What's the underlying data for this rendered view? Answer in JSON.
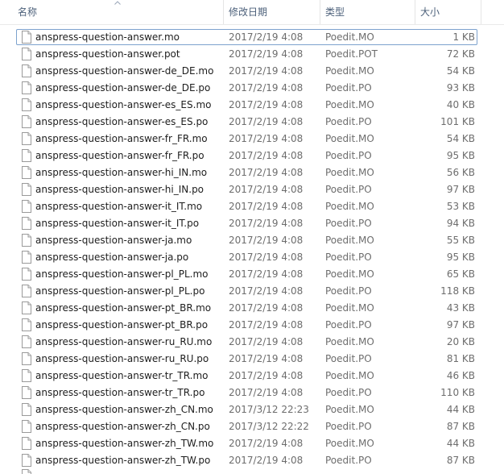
{
  "columns": {
    "name": "名称",
    "date": "修改日期",
    "type": "类型",
    "size": "大小"
  },
  "icons": {
    "file": "file-icon",
    "sort": "sort-ascending-icon"
  },
  "colors": {
    "header_text": "#4c607a",
    "selection_border": "#7da2ce"
  },
  "files": [
    {
      "name": "anspress-question-answer.mo",
      "date": "2017/2/19 4:08",
      "type": "Poedit.MO",
      "size": "1 KB",
      "selected": true
    },
    {
      "name": "anspress-question-answer.pot",
      "date": "2017/2/19 4:08",
      "type": "Poedit.POT",
      "size": "72 KB"
    },
    {
      "name": "anspress-question-answer-de_DE.mo",
      "date": "2017/2/19 4:08",
      "type": "Poedit.MO",
      "size": "54 KB"
    },
    {
      "name": "anspress-question-answer-de_DE.po",
      "date": "2017/2/19 4:08",
      "type": "Poedit.PO",
      "size": "93 KB"
    },
    {
      "name": "anspress-question-answer-es_ES.mo",
      "date": "2017/2/19 4:08",
      "type": "Poedit.MO",
      "size": "40 KB"
    },
    {
      "name": "anspress-question-answer-es_ES.po",
      "date": "2017/2/19 4:08",
      "type": "Poedit.PO",
      "size": "101 KB"
    },
    {
      "name": "anspress-question-answer-fr_FR.mo",
      "date": "2017/2/19 4:08",
      "type": "Poedit.MO",
      "size": "54 KB"
    },
    {
      "name": "anspress-question-answer-fr_FR.po",
      "date": "2017/2/19 4:08",
      "type": "Poedit.PO",
      "size": "95 KB"
    },
    {
      "name": "anspress-question-answer-hi_IN.mo",
      "date": "2017/2/19 4:08",
      "type": "Poedit.MO",
      "size": "56 KB"
    },
    {
      "name": "anspress-question-answer-hi_IN.po",
      "date": "2017/2/19 4:08",
      "type": "Poedit.PO",
      "size": "97 KB"
    },
    {
      "name": "anspress-question-answer-it_IT.mo",
      "date": "2017/2/19 4:08",
      "type": "Poedit.MO",
      "size": "53 KB"
    },
    {
      "name": "anspress-question-answer-it_IT.po",
      "date": "2017/2/19 4:08",
      "type": "Poedit.PO",
      "size": "94 KB"
    },
    {
      "name": "anspress-question-answer-ja.mo",
      "date": "2017/2/19 4:08",
      "type": "Poedit.MO",
      "size": "55 KB"
    },
    {
      "name": "anspress-question-answer-ja.po",
      "date": "2017/2/19 4:08",
      "type": "Poedit.PO",
      "size": "95 KB"
    },
    {
      "name": "anspress-question-answer-pl_PL.mo",
      "date": "2017/2/19 4:08",
      "type": "Poedit.MO",
      "size": "65 KB"
    },
    {
      "name": "anspress-question-answer-pl_PL.po",
      "date": "2017/2/19 4:08",
      "type": "Poedit.PO",
      "size": "118 KB"
    },
    {
      "name": "anspress-question-answer-pt_BR.mo",
      "date": "2017/2/19 4:08",
      "type": "Poedit.MO",
      "size": "43 KB"
    },
    {
      "name": "anspress-question-answer-pt_BR.po",
      "date": "2017/2/19 4:08",
      "type": "Poedit.PO",
      "size": "97 KB"
    },
    {
      "name": "anspress-question-answer-ru_RU.mo",
      "date": "2017/2/19 4:08",
      "type": "Poedit.MO",
      "size": "20 KB"
    },
    {
      "name": "anspress-question-answer-ru_RU.po",
      "date": "2017/2/19 4:08",
      "type": "Poedit.PO",
      "size": "81 KB"
    },
    {
      "name": "anspress-question-answer-tr_TR.mo",
      "date": "2017/2/19 4:08",
      "type": "Poedit.MO",
      "size": "46 KB"
    },
    {
      "name": "anspress-question-answer-tr_TR.po",
      "date": "2017/2/19 4:08",
      "type": "Poedit.PO",
      "size": "110 KB"
    },
    {
      "name": "anspress-question-answer-zh_CN.mo",
      "date": "2017/3/12 22:23",
      "type": "Poedit.MO",
      "size": "44 KB"
    },
    {
      "name": "anspress-question-answer-zh_CN.po",
      "date": "2017/3/12 22:22",
      "type": "Poedit.PO",
      "size": "87 KB"
    },
    {
      "name": "anspress-question-answer-zh_TW.mo",
      "date": "2017/2/19 4:08",
      "type": "Poedit.MO",
      "size": "44 KB"
    },
    {
      "name": "anspress-question-answer-zh_TW.po",
      "date": "2017/2/19 4:08",
      "type": "Poedit.PO",
      "size": "87 KB"
    }
  ]
}
